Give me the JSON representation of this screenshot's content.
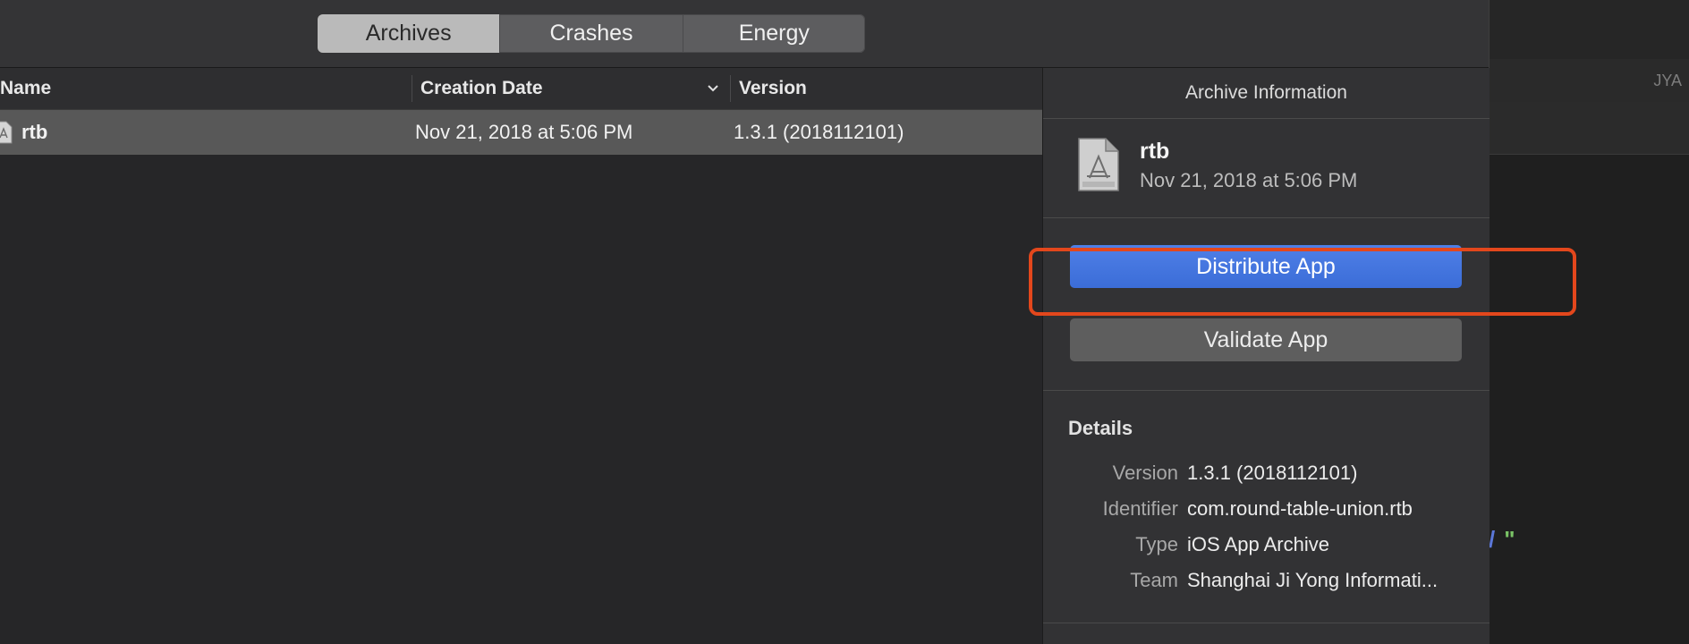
{
  "tabs": [
    "Archives",
    "Crashes",
    "Energy"
  ],
  "list": {
    "columns": {
      "name": "Name",
      "creation_date": "Creation Date",
      "version": "Version"
    },
    "rows": [
      {
        "name": "rtb",
        "creation_date": "Nov 21, 2018 at 5:06 PM",
        "version": "1.3.1 (2018112101)"
      }
    ]
  },
  "inspector": {
    "header": "Archive Information",
    "archive_name": "rtb",
    "archive_date": "Nov 21, 2018 at 5:06 PM",
    "distribute_label": "Distribute App",
    "validate_label": "Validate App",
    "details_title": "Details",
    "details": [
      {
        "key": "Version",
        "value": "1.3.1 (2018112101)"
      },
      {
        "key": "Identifier",
        "value": "com.round-table-union.rtb"
      },
      {
        "key": "Type",
        "value": "iOS App Archive"
      },
      {
        "key": "Team",
        "value": "Shanghai Ji Yong Informati..."
      }
    ]
  },
  "background": {
    "initials": "JYA",
    "code_slash": "/",
    "code_quote": "\""
  },
  "colors": {
    "accent": "#3b6dd8",
    "highlight": "#e3471c"
  }
}
